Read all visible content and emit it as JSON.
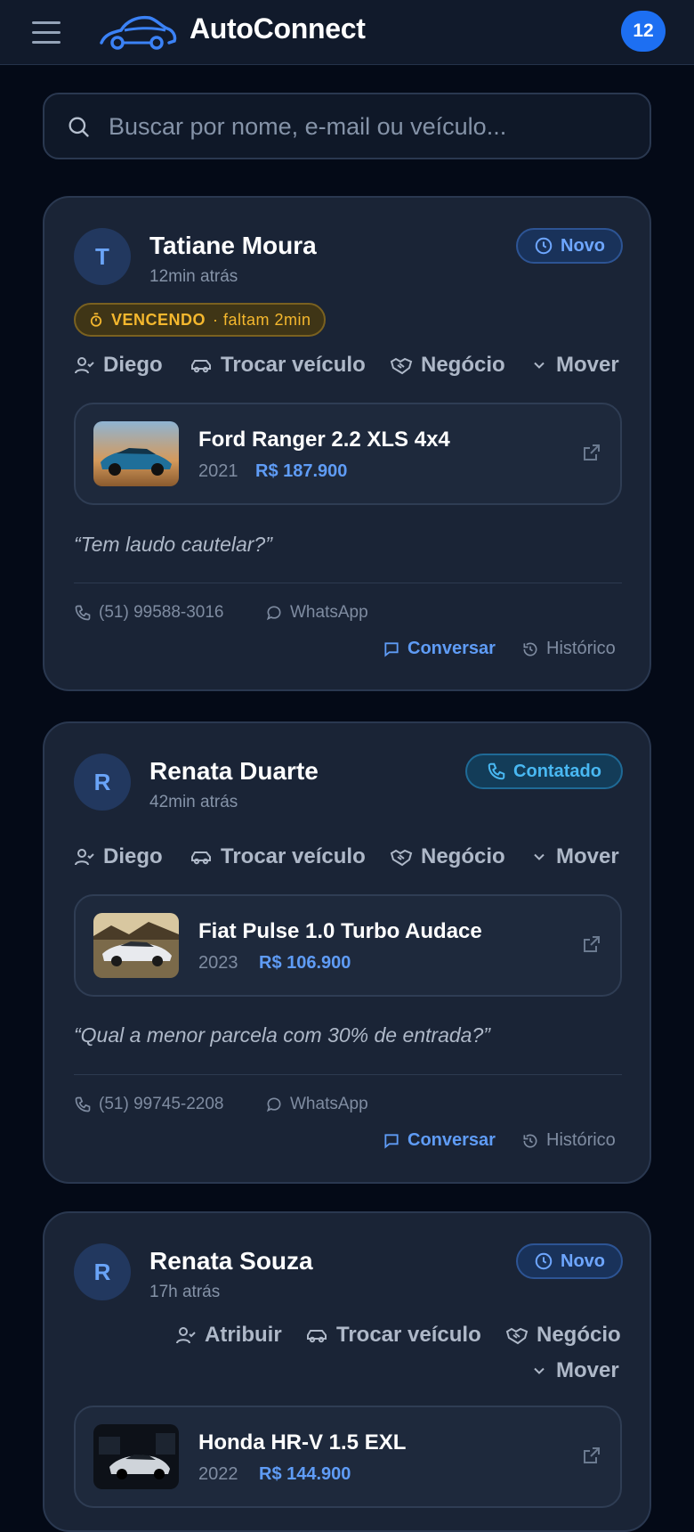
{
  "header": {
    "brand": "AutoConnect",
    "notification_count": "12"
  },
  "search": {
    "placeholder": "Buscar por nome, e-mail ou veículo..."
  },
  "leads": [
    {
      "initial": "T",
      "name": "Tatiane Moura",
      "time": "12min atrás",
      "status": "Novo",
      "urgent_label": "VENCENDO",
      "urgent_detail": "· faltam 2min",
      "actions": {
        "assign": "Diego",
        "swap_vehicle": "Trocar veículo",
        "deal": "Negócio",
        "move": "Mover"
      },
      "vehicle": {
        "name": "Ford Ranger 2.2 XLS 4x4",
        "year": "2021",
        "price": "R$ 187.900"
      },
      "message": "“Tem laudo cautelar?”",
      "phone": "(51) 99588-3016",
      "channel": "WhatsApp",
      "chat_label": "Conversar",
      "history_label": "Histórico"
    },
    {
      "initial": "R",
      "name": "Renata Duarte",
      "time": "42min atrás",
      "status": "Contatado",
      "actions": {
        "assign": "Diego",
        "swap_vehicle": "Trocar veículo",
        "deal": "Negócio",
        "move": "Mover"
      },
      "vehicle": {
        "name": "Fiat Pulse 1.0 Turbo Audace",
        "year": "2023",
        "price": "R$ 106.900"
      },
      "message": "“Qual a menor parcela com 30% de entrada?”",
      "phone": "(51) 99745-2208",
      "channel": "WhatsApp",
      "chat_label": "Conversar",
      "history_label": "Histórico"
    },
    {
      "initial": "R",
      "name": "Renata Souza",
      "time": "17h atrás",
      "status": "Novo",
      "actions": {
        "assign": "Atribuir",
        "swap_vehicle": "Trocar veículo",
        "deal": "Negócio",
        "move": "Mover"
      },
      "vehicle": {
        "name": "Honda HR-V 1.5 EXL",
        "year": "2022",
        "price": "R$ 144.900"
      }
    }
  ],
  "colors": {
    "accent": "#5f9cf6",
    "badge": "#1d6ff2",
    "status_new": "#6ea6ff",
    "status_contacted": "#49b8f2",
    "warning": "#f5b82e"
  }
}
